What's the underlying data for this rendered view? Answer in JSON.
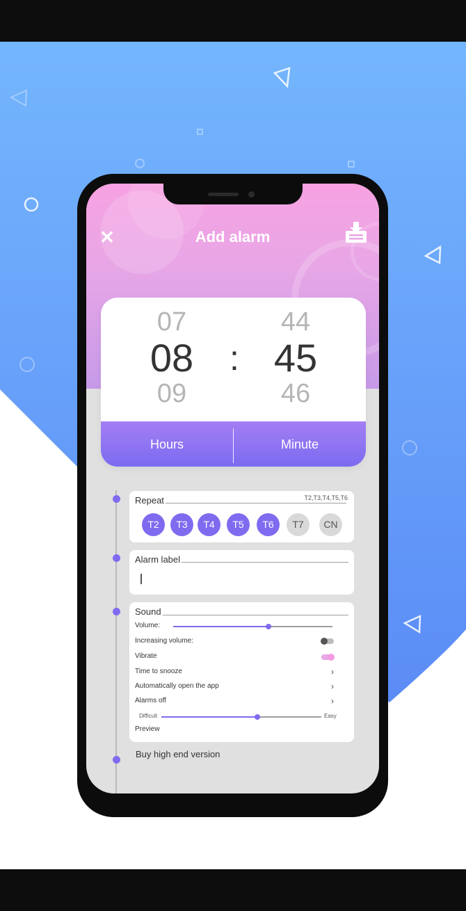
{
  "header": {
    "title": "Add alarm"
  },
  "picker": {
    "hours": {
      "prev": "07",
      "current": "08",
      "next": "09"
    },
    "minutes": {
      "prev": "44",
      "current": "45",
      "next": "46"
    },
    "separator": ":",
    "tabs": {
      "hours_label": "Hours",
      "minute_label": "Minute"
    }
  },
  "repeat": {
    "title": "Repeat",
    "summary": "T2,T3,T4,T5,T6",
    "days": [
      {
        "label": "T2",
        "selected": true
      },
      {
        "label": "T3",
        "selected": true
      },
      {
        "label": "T4",
        "selected": true
      },
      {
        "label": "T5",
        "selected": true
      },
      {
        "label": "T6",
        "selected": true
      },
      {
        "label": "T7",
        "selected": false
      },
      {
        "label": "CN",
        "selected": false
      }
    ]
  },
  "alarm_label": {
    "title": "Alarm label",
    "value": ""
  },
  "sound": {
    "title": "Sound",
    "volume_label": "Volume:",
    "volume_level": 0.6,
    "increasing_volume_label": "Increasing volume:",
    "increasing_volume_on": false,
    "vibrate_label": "Vibrate",
    "vibrate_on": true,
    "time_to_snooze_label": "Time to snooze",
    "auto_open_label": "Automatically open the app",
    "alarms_off_label": "Alarms off",
    "difficulty": {
      "min_label": "Difficult",
      "max_label": "Easy",
      "level": 0.6
    },
    "preview_label": "Preview"
  },
  "buy_label": "Buy high end version",
  "colors": {
    "accent": "#7f6bef",
    "header_pink": "#f7a2e2",
    "background_blue": "#6aa8fb"
  },
  "icons": {
    "close": "close-icon",
    "save": "download-icon",
    "chevron": "chevron-right-icon"
  }
}
